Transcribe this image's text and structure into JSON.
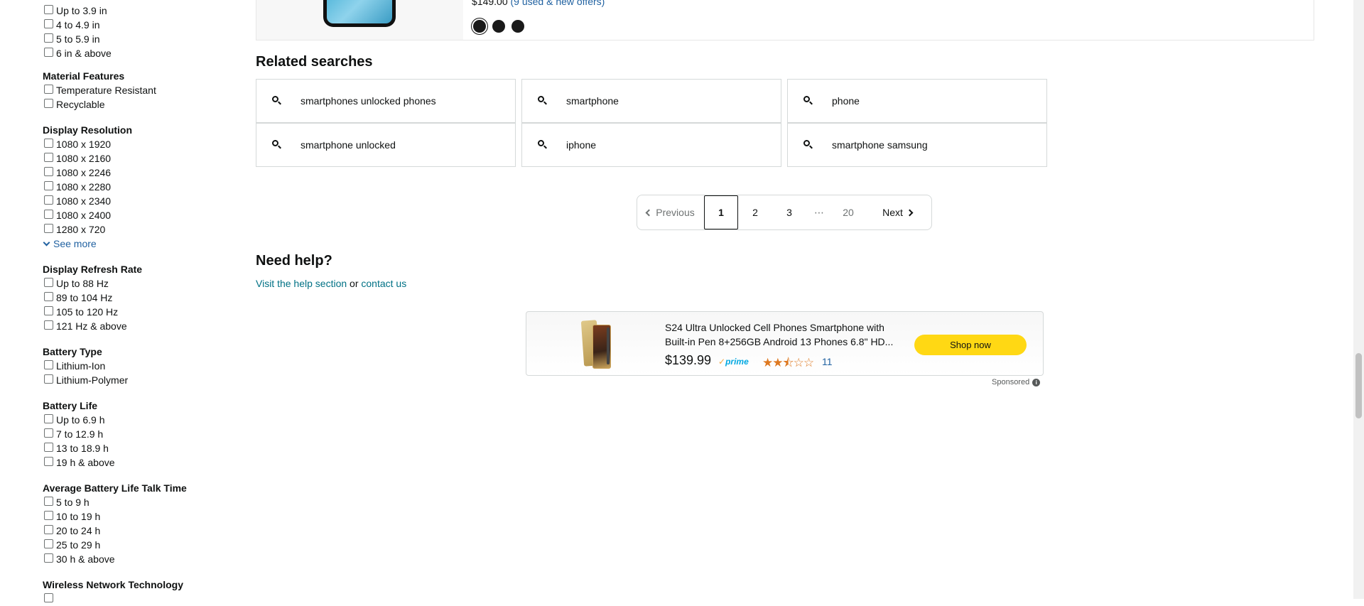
{
  "sidebar": {
    "screen_size_options": [
      "Up to 3.9 in",
      "4 to 4.9 in",
      "5 to 5.9 in",
      "6 in & above"
    ],
    "material_features": {
      "title": "Material Features",
      "options": [
        "Temperature Resistant",
        "Recyclable"
      ]
    },
    "display_resolution": {
      "title": "Display Resolution",
      "options": [
        "1080 x 1920",
        "1080 x 2160",
        "1080 x 2246",
        "1080 x 2280",
        "1080 x 2340",
        "1080 x 2400",
        "1280 x 720"
      ],
      "see_more": "See more"
    },
    "display_refresh_rate": {
      "title": "Display Refresh Rate",
      "options": [
        "Up to 88 Hz",
        "89 to 104 Hz",
        "105 to 120 Hz",
        "121 Hz & above"
      ]
    },
    "battery_type": {
      "title": "Battery Type",
      "options": [
        "Lithium-Ion",
        "Lithium-Polymer"
      ]
    },
    "battery_life": {
      "title": "Battery Life",
      "options": [
        "Up to 6.9 h",
        "7 to 12.9 h",
        "13 to 18.9 h",
        "19 h & above"
      ]
    },
    "talk_time": {
      "title": "Average Battery Life Talk Time",
      "options": [
        "5 to 9 h",
        "10 to 19 h",
        "20 to 24 h",
        "25 to 29 h",
        "30 h & above"
      ]
    },
    "wireless": {
      "title": "Wireless Network Technology"
    }
  },
  "product": {
    "price": "$149.00",
    "offers": "(9 used & new offers)"
  },
  "related": {
    "title": "Related searches",
    "items": [
      "smartphones unlocked phones",
      "smartphone",
      "phone",
      "smartphone unlocked",
      "iphone",
      "smartphone samsung"
    ]
  },
  "pagination": {
    "previous": "Previous",
    "pages": [
      "1",
      "2",
      "3"
    ],
    "dots": "⋯",
    "last": "20",
    "next": "Next",
    "current": "1"
  },
  "help": {
    "title": "Need help?",
    "link1": "Visit the help section",
    "or": " or ",
    "link2": "contact us"
  },
  "ad": {
    "title": "S24 Ultra Unlocked Cell Phones Smartphone with Built-in Pen 8+256GB Android 13 Phones 6.8\" HD...",
    "price": "$139.99",
    "prime": "prime",
    "rating": 2.5,
    "stars_text": "★★⯪☆☆",
    "review_count": "11",
    "cta": "Shop now",
    "sponsored": "Sponsored",
    "colors": {
      "cta_bg": "#ffd814",
      "link": "#2162a1",
      "stars": "#de7921"
    }
  }
}
